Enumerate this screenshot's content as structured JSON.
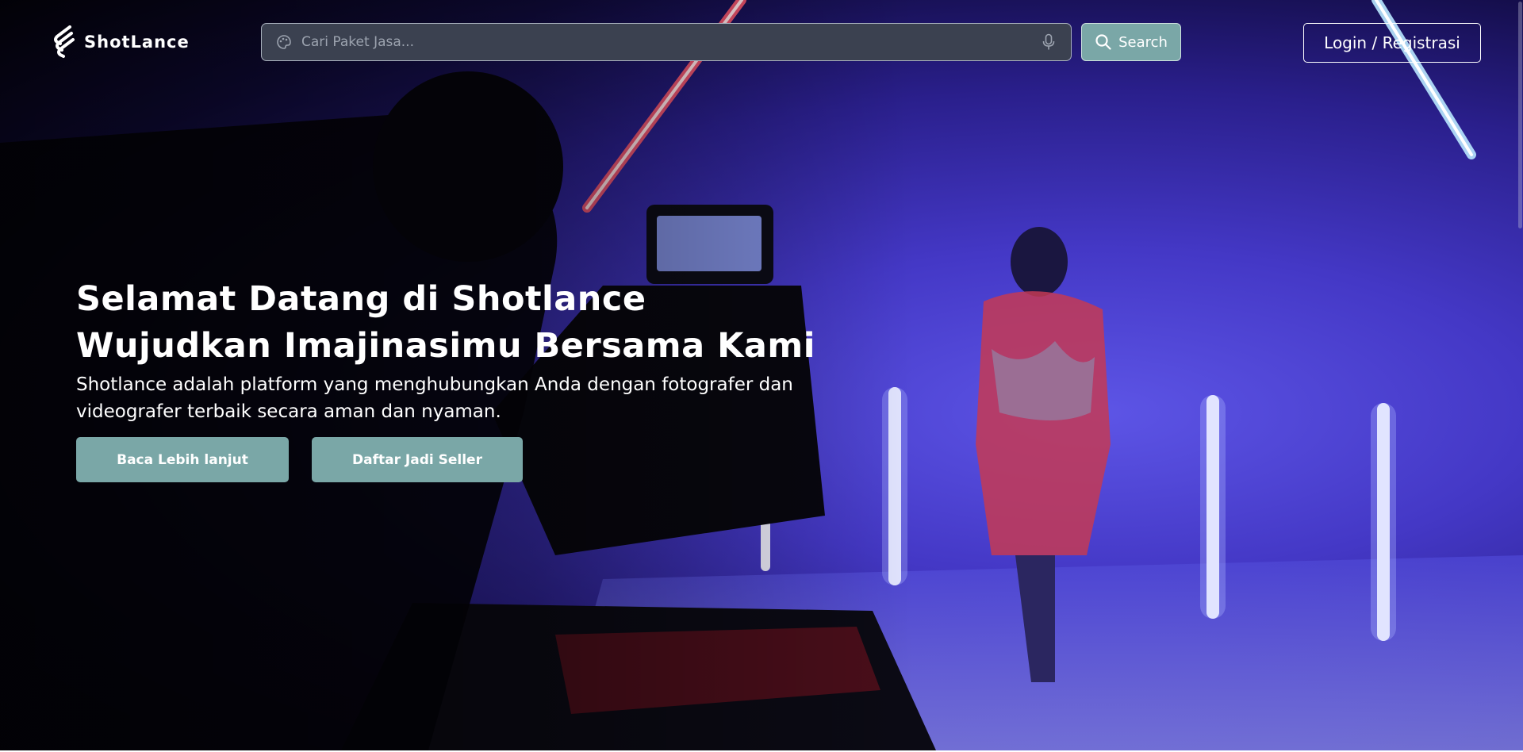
{
  "header": {
    "logo_text": "ShotLance",
    "logo_icon": "shotlance-logo-icon",
    "search": {
      "placeholder": "Cari Paket Jasa...",
      "value": "",
      "left_icon": "palette-icon",
      "right_icon": "microphone-icon"
    },
    "search_button": {
      "label": "Search",
      "icon": "search-icon"
    },
    "login_button": {
      "label": "Login / Registrasi"
    }
  },
  "hero": {
    "title_line1": "Selamat Datang di Shotlance",
    "title_line2": "Wujudkan Imajinasimu Bersama Kami",
    "subtitle": "Shotlance adalah platform yang menghubungkan Anda dengan fotografer dan videografer terbaik secara aman dan nyaman.",
    "buttons": [
      {
        "label": "Baca Lebih lanjut"
      },
      {
        "label": "Daftar Jadi Seller"
      }
    ]
  },
  "colors": {
    "accent": "#7aa7a7",
    "search_bg": "#3b4150",
    "text": "#ffffff"
  }
}
